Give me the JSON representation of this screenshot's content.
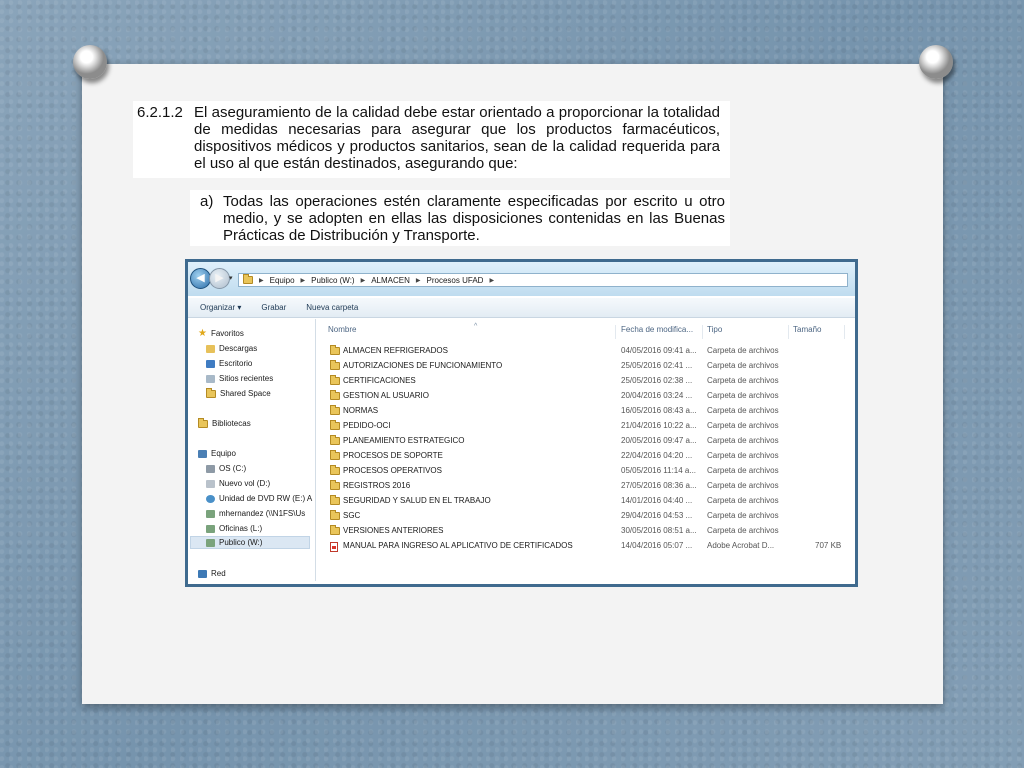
{
  "document": {
    "section_number": "6.2.1.2",
    "section_text": "El aseguramiento de la calidad debe estar orientado a proporcionar la totalidad de medidas necesarias para asegurar que los productos farmacéuticos, dispositivos médicos y productos sanitarios, sean de la calidad requerida para el uso al que están destinados, asegurando que:",
    "item_marker": "a)",
    "item_text": "Todas las operaciones estén claramente especificadas por escrito u otro medio, y se adopten en ellas las disposiciones contenidas en las Buenas Prácticas de Distribución y Transporte."
  },
  "explorer": {
    "breadcrumbs": [
      "Equipo",
      "Publico (W:)",
      "ALMACEN",
      "Procesos UFAD"
    ],
    "toolbar": {
      "organize": "Organizar ▾",
      "burn": "Grabar",
      "new_folder": "Nueva carpeta"
    },
    "nav": {
      "favorites": "Favoritos",
      "downloads": "Descargas",
      "desktop": "Escritorio",
      "recent": "Sitios recientes",
      "shared": "Shared Space",
      "libraries": "Bibliotecas",
      "computer": "Equipo",
      "os": "OS (C:)",
      "nuevo_vol": "Nuevo vol (D:)",
      "dvd": "Unidad de DVD RW (E:) A",
      "mhernandez": "mhernandez (\\\\N1FS\\Us",
      "oficinas": "Oficinas (L:)",
      "publico": "Publico (W:)",
      "network": "Red"
    },
    "columns": {
      "name": "Nombre",
      "date": "Fecha de modifica...",
      "type": "Tipo",
      "size": "Tamaño"
    },
    "files": [
      {
        "name": "ALMACEN REFRIGERADOS",
        "date": "04/05/2016 09:41 a...",
        "type": "Carpeta de archivos",
        "size": "",
        "icon": "folder-icon"
      },
      {
        "name": "AUTORIZACIONES DE FUNCIONAMIENTO",
        "date": "25/05/2016 02:41 ...",
        "type": "Carpeta de archivos",
        "size": "",
        "icon": "folder-icon"
      },
      {
        "name": "CERTIFICACIONES",
        "date": "25/05/2016 02:38 ...",
        "type": "Carpeta de archivos",
        "size": "",
        "icon": "folder-icon"
      },
      {
        "name": "GESTION AL USUARIO",
        "date": "20/04/2016 03:24 ...",
        "type": "Carpeta de archivos",
        "size": "",
        "icon": "folder-icon"
      },
      {
        "name": "NORMAS",
        "date": "16/05/2016 08:43 a...",
        "type": "Carpeta de archivos",
        "size": "",
        "icon": "folder-icon"
      },
      {
        "name": "PEDIDO-OCI",
        "date": "21/04/2016 10:22 a...",
        "type": "Carpeta de archivos",
        "size": "",
        "icon": "folder-icon"
      },
      {
        "name": "PLANEAMIENTO ESTRATEGICO",
        "date": "20/05/2016 09:47 a...",
        "type": "Carpeta de archivos",
        "size": "",
        "icon": "folder-icon"
      },
      {
        "name": "PROCESOS DE SOPORTE",
        "date": "22/04/2016 04:20 ...",
        "type": "Carpeta de archivos",
        "size": "",
        "icon": "folder-icon"
      },
      {
        "name": "PROCESOS OPERATIVOS",
        "date": "05/05/2016 11:14 a...",
        "type": "Carpeta de archivos",
        "size": "",
        "icon": "folder-icon"
      },
      {
        "name": "REGISTROS 2016",
        "date": "27/05/2016 08:36 a...",
        "type": "Carpeta de archivos",
        "size": "",
        "icon": "folder-icon"
      },
      {
        "name": "SEGURIDAD Y SALUD EN EL TRABAJO",
        "date": "14/01/2016 04:40 ...",
        "type": "Carpeta de archivos",
        "size": "",
        "icon": "folder-icon"
      },
      {
        "name": "SGC",
        "date": "29/04/2016 04:53 ...",
        "type": "Carpeta de archivos",
        "size": "",
        "icon": "folder-icon"
      },
      {
        "name": "VERSIONES ANTERIORES",
        "date": "30/05/2016 08:51 a...",
        "type": "Carpeta de archivos",
        "size": "",
        "icon": "folder-icon"
      },
      {
        "name": "MANUAL PARA INGRESO AL APLICATIVO DE CERTIFICADOS",
        "date": "14/04/2016 05:07 ...",
        "type": "Adobe Acrobat D...",
        "size": "707 KB",
        "icon": "pdf-icon"
      }
    ]
  }
}
